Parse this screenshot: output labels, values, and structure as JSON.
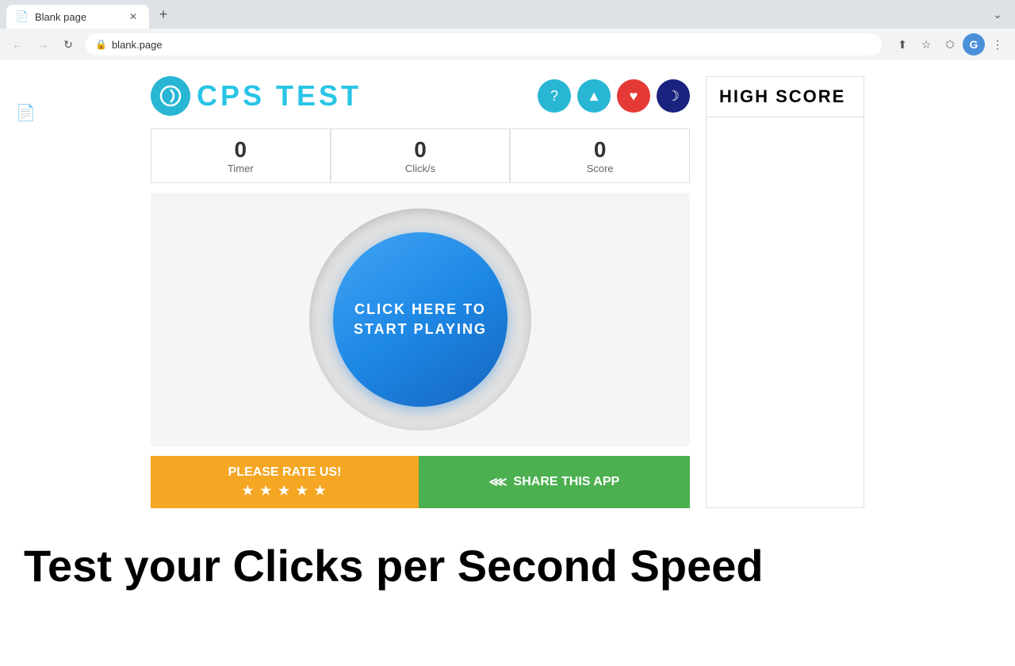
{
  "browser": {
    "tab_title": "Blank page",
    "tab_favicon": "📄",
    "url": "blank.page",
    "new_tab_label": "+",
    "tab_list_label": "⌄"
  },
  "nav": {
    "back": "←",
    "forward": "→",
    "reload": "↻",
    "lock_icon": "🔒",
    "share_icon": "⬆",
    "bookmark_icon": "☆",
    "extensions_icon": "⬡",
    "settings_icon": "⋮",
    "profile_letter": "G"
  },
  "header": {
    "logo_symbol": "↻",
    "title": "CPS TEST",
    "help_icon": "?",
    "upload_icon": "▲",
    "heart_icon": "♥",
    "moon_icon": "☽"
  },
  "stats": {
    "timer_value": "0",
    "timer_label": "Timer",
    "clicks_value": "0",
    "clicks_label": "Click/s",
    "score_value": "0",
    "score_label": "Score"
  },
  "game": {
    "click_button_line1": "CLICK HERE TO",
    "click_button_line2": "START PLAYING"
  },
  "bottom_buttons": {
    "rate_label": "PLEASE RATE US!",
    "rate_stars": "★ ★ ★ ★ ★",
    "share_label": "SHARE THIS APP",
    "share_icon": "⋘"
  },
  "high_score": {
    "title": "HIGH SCORE"
  },
  "page_tagline": "Test your Clicks per Second Speed"
}
